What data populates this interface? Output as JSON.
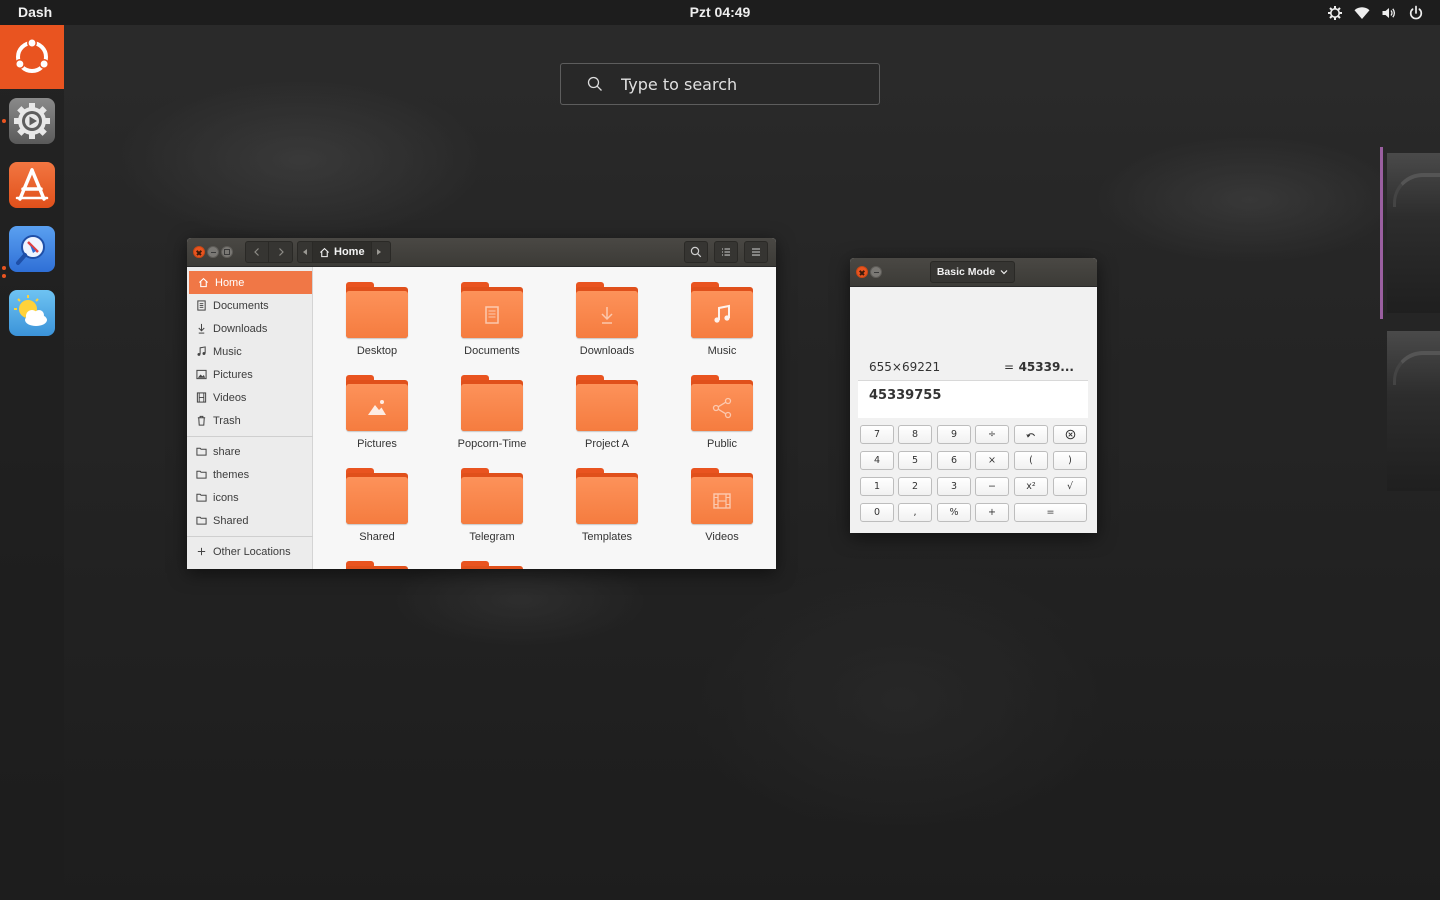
{
  "top_panel": {
    "title": "Dash",
    "clock": "Pzt 04:49"
  },
  "tray_icons": [
    "settings-gear-icon",
    "wifi-icon",
    "volume-icon",
    "power-icon"
  ],
  "launcher": {
    "items": [
      {
        "name": "ubuntu-logo-icon",
        "active": true
      },
      {
        "name": "system-settings-icon",
        "running": true
      },
      {
        "name": "software-center-icon"
      },
      {
        "name": "web-browser-icon",
        "running": true,
        "windows": 2
      },
      {
        "name": "weather-icon"
      }
    ]
  },
  "search": {
    "placeholder": "Type to search"
  },
  "file_manager": {
    "path": {
      "current": "Home"
    },
    "sidebar": {
      "places": [
        {
          "label": "Home",
          "icon": "home-icon",
          "active": true
        },
        {
          "label": "Documents",
          "icon": "document-icon"
        },
        {
          "label": "Downloads",
          "icon": "download-icon"
        },
        {
          "label": "Music",
          "icon": "music-icon"
        },
        {
          "label": "Pictures",
          "icon": "picture-icon"
        },
        {
          "label": "Videos",
          "icon": "video-icon"
        },
        {
          "label": "Trash",
          "icon": "trash-icon"
        }
      ],
      "bookmarks": [
        {
          "label": "share",
          "icon": "folder-icon"
        },
        {
          "label": "themes",
          "icon": "folder-icon"
        },
        {
          "label": "icons",
          "icon": "folder-icon"
        },
        {
          "label": "Shared",
          "icon": "folder-icon"
        }
      ],
      "other": {
        "label": "Other Locations",
        "icon": "plus-icon"
      }
    },
    "folders": [
      {
        "label": "Desktop",
        "emblem": ""
      },
      {
        "label": "Documents",
        "emblem": "document"
      },
      {
        "label": "Downloads",
        "emblem": "download"
      },
      {
        "label": "Music",
        "emblem": "music"
      },
      {
        "label": "Pictures",
        "emblem": "picture"
      },
      {
        "label": "Popcorn-Time",
        "emblem": ""
      },
      {
        "label": "Project A",
        "emblem": ""
      },
      {
        "label": "Public",
        "emblem": "share"
      },
      {
        "label": "Shared",
        "emblem": ""
      },
      {
        "label": "Telegram",
        "emblem": ""
      },
      {
        "label": "Templates",
        "emblem": ""
      },
      {
        "label": "Videos",
        "emblem": "video"
      }
    ]
  },
  "calculator": {
    "mode": "Basic Mode",
    "history": {
      "expression": "655×69221",
      "equals": "=",
      "result": "45339..."
    },
    "display": "45339755",
    "keys": [
      [
        "7",
        "8",
        "9",
        "÷",
        "↶",
        "⊗"
      ],
      [
        "4",
        "5",
        "6",
        "×",
        "(",
        ")"
      ],
      [
        "1",
        "2",
        "3",
        "−",
        "x²",
        "√"
      ],
      [
        "0",
        ",",
        "%",
        "+",
        "="
      ]
    ]
  }
}
